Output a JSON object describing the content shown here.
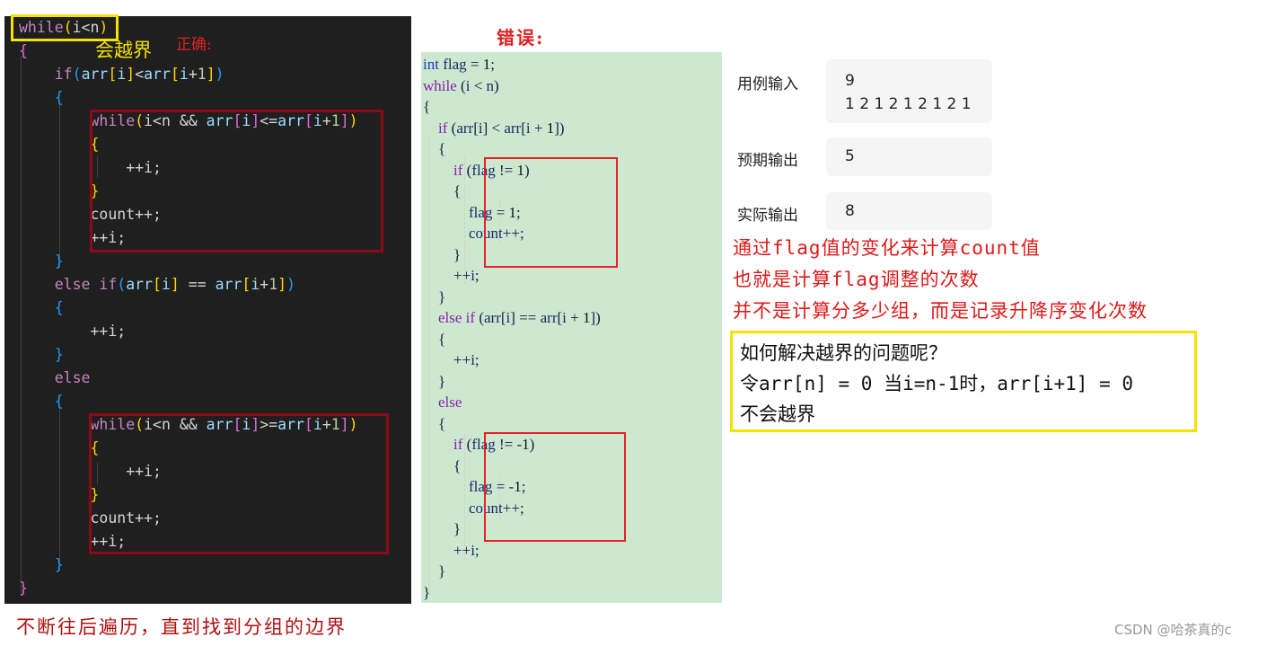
{
  "correct_panel": {
    "note_overflow": "会越界",
    "note_correct": "正确:",
    "code_lines": [
      "while(i<n)",
      "{",
      "    if(arr[i]<arr[i+1])",
      "    {",
      "        while(i<n && arr[i]<=arr[i+1])",
      "        {",
      "            ++i;",
      "        }",
      "        count++;",
      "        ++i;",
      "    }",
      "    else if(arr[i] == arr[i+1])",
      "    {",
      "        ++i;",
      "    }",
      "    else",
      "    {",
      "        while(i<n && arr[i]>=arr[i+1])",
      "        {",
      "            ++i;",
      "        }",
      "        count++;",
      "        ++i;",
      "    }",
      "}"
    ],
    "caption": "不断往后遍历，直到找到分组的边界"
  },
  "wrong_panel": {
    "title": "错误:",
    "code_lines": [
      "int flag = 1;",
      "while (i < n)",
      "{",
      "    if (arr[i] < arr[i + 1])",
      "    {",
      "        if (flag != 1)",
      "        {",
      "            flag = 1;",
      "            count++;",
      "        }",
      "        ++i;",
      "    }",
      "    else if (arr[i] == arr[i + 1])",
      "    {",
      "        ++i;",
      "    }",
      "    else",
      "    {",
      "        if (flag != -1)",
      "        {",
      "            flag = -1;",
      "            count++;",
      "        }",
      "        ++i;",
      "    }",
      "}"
    ]
  },
  "test_result": {
    "input_label": "用例输入",
    "input_line1": "9",
    "input_line2": "1 2 1 2 1 2 1 2 1",
    "expected_label": "预期输出",
    "expected_value": "5",
    "actual_label": "实际输出",
    "actual_value": "8"
  },
  "notes": {
    "line1": "通过flag值的变化来计算count值",
    "line2": "也就是计算flag调整的次数",
    "line3": "并不是计算分多少组，而是记录升降序变化次数"
  },
  "answer": {
    "line1": "如何解决越界的问题呢？",
    "line2": "令arr[n] = 0 当i=n-1时，arr[i+1] = 0",
    "line3": "不会越界"
  },
  "watermark": "CSDN @哈茶真的c",
  "colors": {
    "editor_bg": "#1f1f1f",
    "green_bg": "#cce8cf",
    "highlight_yellow": "#f5e200",
    "highlight_red": "#e8202a",
    "dark_red_box": "#8b0a14",
    "note_red": "#e01818"
  }
}
